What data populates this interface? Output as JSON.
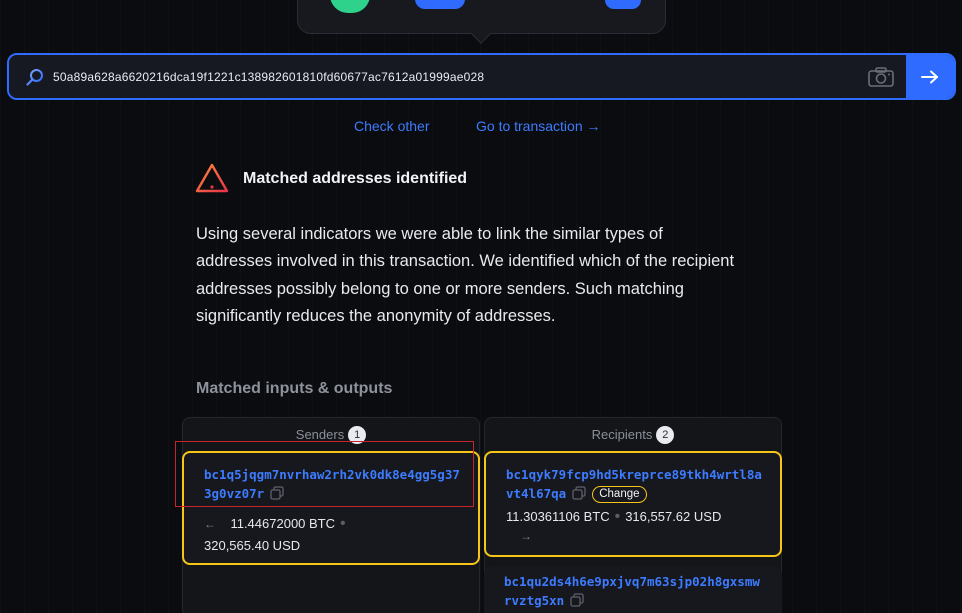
{
  "search": {
    "value": "50a89a628a6620216dca19f1221c138982601810fd60677ac7612a01999ae028"
  },
  "links": {
    "check_other": "Check other",
    "go_to_transaction": "Go to transaction →"
  },
  "result": {
    "heading": "Matched addresses identified",
    "description": "Using several indicators we were able to link the similar types of addresses involved in this transaction. We identified which of the recipient addresses possibly belong to one or more senders. Such matching significantly reduces the anonymity of addresses."
  },
  "matched": {
    "title": "Matched inputs & outputs",
    "senders": {
      "label": "Senders",
      "count": "1",
      "items": [
        {
          "address": "bc1q5jqgm7nvrhaw2rh2vk0dk8e4gg5g373g0vz07r",
          "btc": "11.44672000 BTC",
          "usd": "320,565.40 USD"
        }
      ]
    },
    "recipients": {
      "label": "Recipients",
      "count": "2",
      "items": [
        {
          "address": "bc1qyk79fcp9hd5kreprce89tkh4wrtl8avt4l67qa",
          "badge": "Change",
          "btc": "11.30361106 BTC",
          "usd": "316,557.62 USD"
        },
        {
          "address": "bc1qu2ds4h6e9pxjvq7m63sjp02h8gxsmwrvztg5xn"
        }
      ]
    }
  },
  "colors": {
    "accent": "#2f6bff",
    "link": "#3d7bff",
    "highlight": "#f5c518",
    "danger": "#e8334a"
  }
}
